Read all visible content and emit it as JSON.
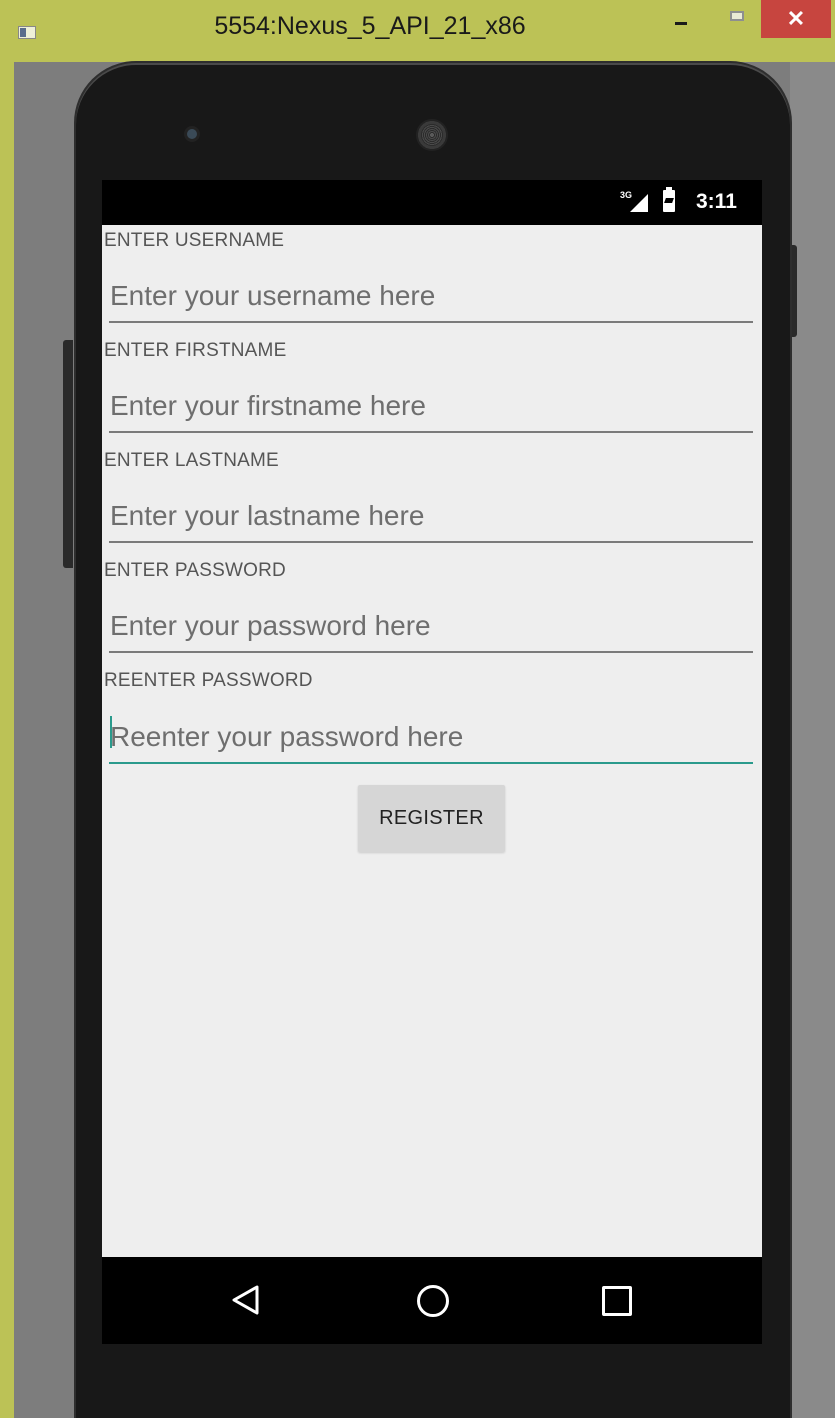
{
  "window": {
    "title": "5554:Nexus_5_API_21_x86",
    "close_glyph": "✕"
  },
  "status_bar": {
    "network_label": "3G",
    "time": "3:11"
  },
  "form": {
    "fields": [
      {
        "label": "ENTER USERNAME",
        "placeholder": "Enter your username here",
        "value": ""
      },
      {
        "label": "ENTER FIRSTNAME",
        "placeholder": "Enter your firstname here",
        "value": ""
      },
      {
        "label": "ENTER LASTNAME",
        "placeholder": "Enter your lastname here",
        "value": ""
      },
      {
        "label": "ENTER PASSWORD",
        "placeholder": "Enter your password here",
        "value": ""
      },
      {
        "label": "REENTER PASSWORD",
        "placeholder": "Reenter your password here",
        "value": ""
      }
    ],
    "register_label": "REGISTER",
    "accent_color": "#2a9a8c"
  },
  "nav_bar": {
    "icons": [
      "back-icon",
      "home-icon",
      "recent-apps-icon"
    ]
  }
}
